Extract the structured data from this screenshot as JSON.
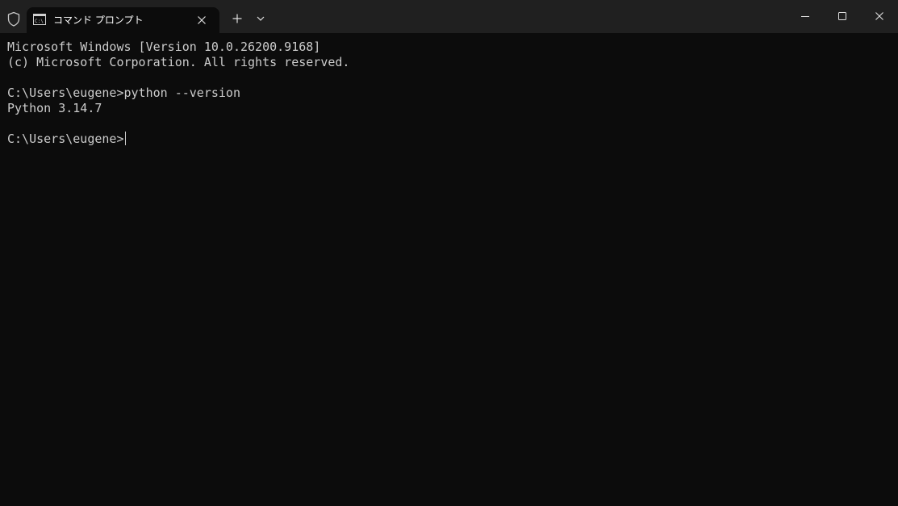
{
  "tab": {
    "title": "コマンド プロンプト",
    "icon": "cmd-prompt-icon"
  },
  "titlebar_icons": {
    "shield": "shield-icon",
    "close_tab": "close-icon",
    "new_tab": "plus-icon",
    "dropdown": "chevron-down-icon",
    "minimize": "minimize-icon",
    "maximize": "maximize-icon",
    "close_window": "close-icon"
  },
  "colors": {
    "titlebar_bg": "#202020",
    "terminal_bg": "#0c0c0c",
    "text": "#cccccc"
  },
  "terminal": {
    "lines": [
      "Microsoft Windows [Version 10.0.26200.9168]",
      "(c) Microsoft Corporation. All rights reserved.",
      "",
      "C:\\Users\\eugene>python --version",
      "Python 3.14.7",
      ""
    ],
    "prompt": "C:\\Users\\eugene>"
  }
}
